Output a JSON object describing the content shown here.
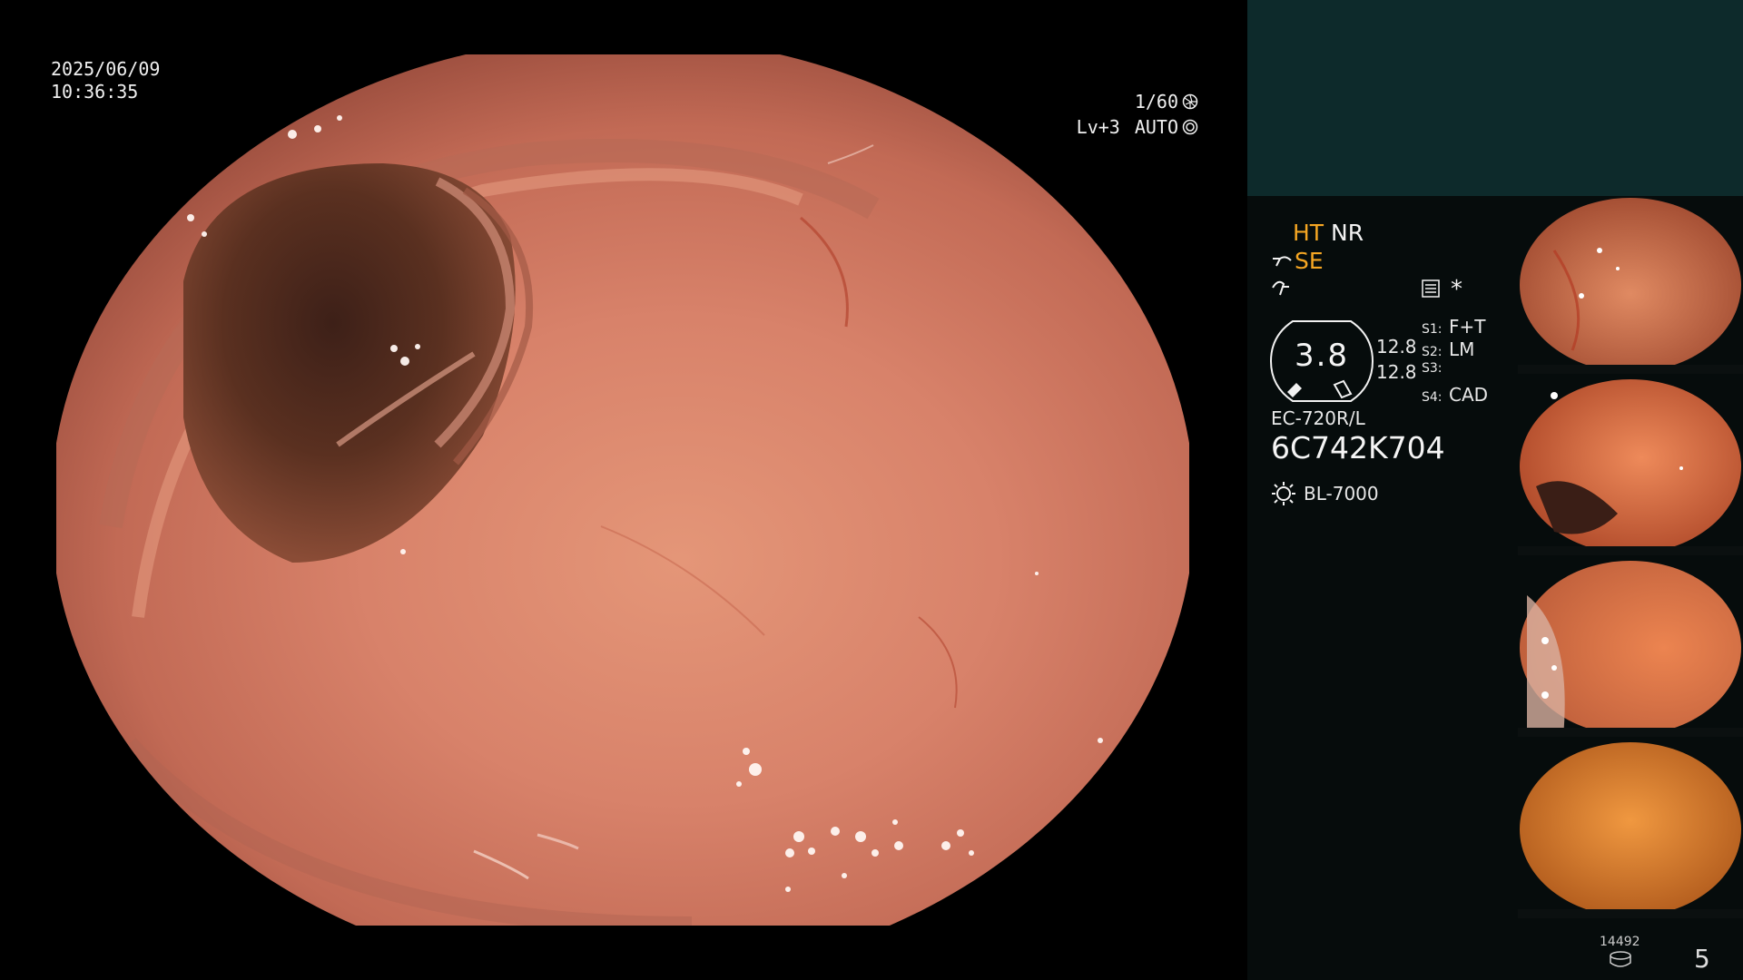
{
  "overlay": {
    "date": "2025/06/09",
    "time": "10:36:35",
    "shutter": "1/60",
    "level": "Lv+3",
    "auto": "AUTO"
  },
  "modes": {
    "ht": "HT",
    "nr": "NR",
    "se": "SE"
  },
  "gauge": {
    "value": "3.8",
    "n1": "12.8",
    "n2": "12.8"
  },
  "switches": [
    {
      "key": "S1:",
      "value": "F+T"
    },
    {
      "key": "S2:",
      "value": "LM"
    },
    {
      "key": "S3:",
      "value": ""
    },
    {
      "key": "S4:",
      "value": "CAD"
    }
  ],
  "scope": {
    "model": "EC-720R/L",
    "serial": "6C742K704",
    "light_source": "BL-7000"
  },
  "footer": {
    "counter": "14492",
    "page": "5"
  },
  "thumbnails": [
    {
      "label": "capture-1"
    },
    {
      "label": "capture-2"
    },
    {
      "label": "capture-3"
    },
    {
      "label": "capture-4"
    }
  ],
  "colors": {
    "accent_orange": "#f5a623",
    "panel_teal": "#0d2a2b",
    "panel_dark": "#060c0c",
    "mucosa": "#d9826a"
  },
  "icons": [
    "shutter-icon",
    "auto-iris-icon",
    "structure-enhance-icon",
    "enhance-icon",
    "memory-icon",
    "light-source-icon",
    "disk-icon"
  ]
}
